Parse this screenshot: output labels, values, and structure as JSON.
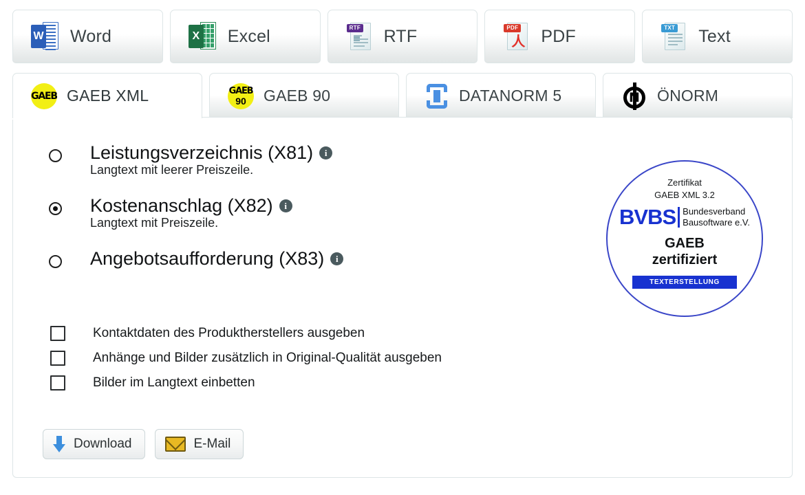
{
  "format_tabs": [
    {
      "label": "Word",
      "icon": "word-icon"
    },
    {
      "label": "Excel",
      "icon": "excel-icon"
    },
    {
      "label": "RTF",
      "icon": "rtf-document-icon",
      "badge": "RTF",
      "badge_color": "#5b2d8e"
    },
    {
      "label": "PDF",
      "icon": "pdf-document-icon",
      "badge": "PDF",
      "badge_color": "#d93a2b"
    },
    {
      "label": "Text",
      "icon": "txt-document-icon",
      "badge": "TXT",
      "badge_color": "#3a9bd4"
    }
  ],
  "standard_tabs": [
    {
      "label": "GAEB XML",
      "icon": "gaeb-icon",
      "active": true
    },
    {
      "label": "GAEB 90",
      "icon": "gaeb-90-icon",
      "active": false
    },
    {
      "label": "DATANORM 5",
      "icon": "datanorm-icon",
      "active": false
    },
    {
      "label": "ÖNORM",
      "icon": "oenorm-icon",
      "active": false
    }
  ],
  "options": [
    {
      "title": "Leistungsverzeichnis (X81)",
      "subtitle": "Langtext mit leerer Preiszeile.",
      "selected": false,
      "info": "i"
    },
    {
      "title": "Kostenanschlag (X82)",
      "subtitle": "Langtext mit Preiszeile.",
      "selected": true,
      "info": "i"
    },
    {
      "title": "Angebotsaufforderung (X83)",
      "subtitle": "",
      "selected": false,
      "info": "i"
    }
  ],
  "checkboxes": [
    {
      "label": "Kontaktdaten des Produktherstellers ausgeben",
      "checked": false
    },
    {
      "label": "Anhänge und Bilder zusätzlich in Original-Qualität ausgeben",
      "checked": false
    },
    {
      "label": "Bilder im Langtext einbetten",
      "checked": false
    }
  ],
  "buttons": [
    {
      "label": "Download",
      "icon": "download-arrow-icon"
    },
    {
      "label": "E-Mail",
      "icon": "envelope-icon"
    }
  ],
  "seal": {
    "line1": "Zertifikat",
    "line2": "GAEB XML 3.2",
    "brand": "BVBS",
    "brand_sub_line1": "Bundesverband",
    "brand_sub_line2": "Bausoftware e.V.",
    "line3": "GAEB",
    "line4": "zertifiziert",
    "ribbon": "TEXTERSTELLUNG",
    "color": "#1832d0"
  },
  "glyphs": {
    "word_letter": "W",
    "excel_letter": "X",
    "gaeb_text": "GAEB",
    "gaeb_90": "90",
    "oenorm_letter": "N",
    "pdf_swirl": "人"
  }
}
